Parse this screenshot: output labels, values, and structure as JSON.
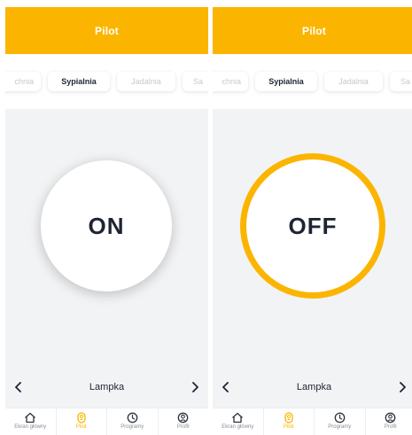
{
  "screens": [
    {
      "header_title": "Pilot",
      "tabs": [
        {
          "label": "chnia",
          "active": false
        },
        {
          "label": "Sypialnia",
          "active": true
        },
        {
          "label": "Jadalnia",
          "active": false
        },
        {
          "label": "Sa",
          "active": false
        }
      ],
      "power_label": "ON",
      "power_state": "on",
      "device_name": "Lampka",
      "nav": [
        {
          "label": "Ekran główny",
          "icon": "home-icon"
        },
        {
          "label": "Pilot",
          "icon": "remote-icon",
          "active": true
        },
        {
          "label": "Programy",
          "icon": "clock-icon"
        },
        {
          "label": "Profil",
          "icon": "profile-icon"
        }
      ]
    },
    {
      "header_title": "Pilot",
      "tabs": [
        {
          "label": "chnia",
          "active": false
        },
        {
          "label": "Sypialnia",
          "active": true
        },
        {
          "label": "Jadalnia",
          "active": false
        },
        {
          "label": "Sa",
          "active": false
        }
      ],
      "power_label": "OFF",
      "power_state": "off",
      "device_name": "Lampka",
      "nav": [
        {
          "label": "Ekran główny",
          "icon": "home-icon"
        },
        {
          "label": "Pilot",
          "icon": "remote-icon",
          "active": true
        },
        {
          "label": "Programy",
          "icon": "clock-icon"
        },
        {
          "label": "Profil",
          "icon": "profile-icon"
        }
      ]
    }
  ],
  "colors": {
    "accent": "#fbb500",
    "text_dark": "#1f2433",
    "inactive_text": "#c6c8cc",
    "background": "#f2f3f5"
  }
}
